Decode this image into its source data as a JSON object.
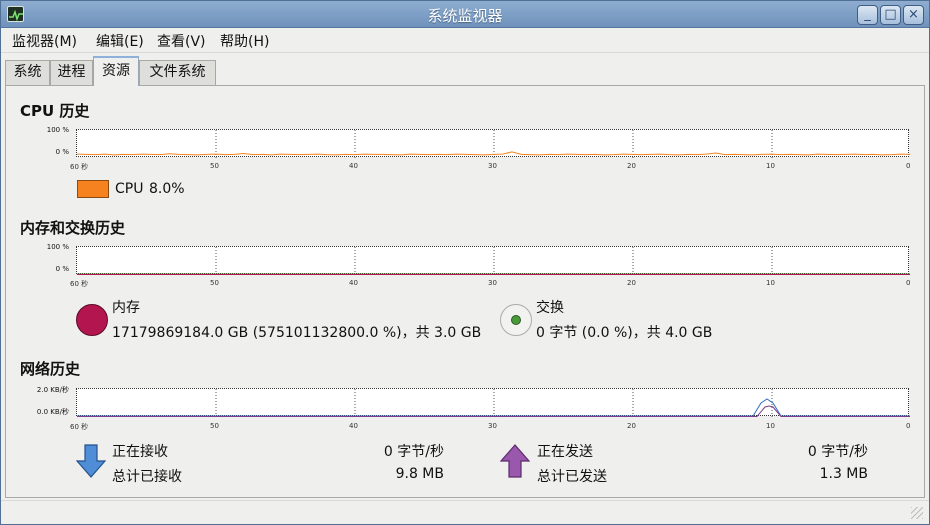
{
  "window": {
    "title": "系统监视器",
    "icon": "system-monitor-icon",
    "controls": {
      "minimize": "_",
      "maximize": "□",
      "close": "×"
    }
  },
  "menu": [
    {
      "label": "监视器(M)"
    },
    {
      "label": "编辑(E)"
    },
    {
      "label": "查看(V)"
    },
    {
      "label": "帮助(H)"
    }
  ],
  "tabs": [
    {
      "label": "系统",
      "active": false
    },
    {
      "label": "进程",
      "active": false
    },
    {
      "label": "资源",
      "active": true
    },
    {
      "label": "文件系统",
      "active": false
    }
  ],
  "x_ticks": [
    "60 秒",
    "50",
    "40",
    "30",
    "20",
    "10",
    "0"
  ],
  "cpu": {
    "title": "CPU 历史",
    "y_ticks": [
      "100 %",
      "0 %"
    ],
    "legend_label": "CPU",
    "legend_value": "8.0%",
    "color": "#f5821f",
    "series_percent": [
      14,
      13,
      12,
      14,
      11,
      13,
      12,
      14,
      13,
      12,
      15,
      13,
      12,
      11,
      13,
      14,
      12,
      13,
      16,
      12,
      13,
      11,
      14,
      13,
      12,
      13,
      14,
      12,
      11,
      13,
      12,
      14,
      13,
      13,
      12,
      11,
      14,
      13,
      12,
      13,
      12,
      14,
      13,
      12,
      11,
      13,
      14,
      22,
      13,
      12,
      11,
      13,
      12,
      14,
      13,
      12,
      13,
      11,
      12,
      14,
      13,
      12,
      13,
      14,
      12,
      11,
      13,
      12,
      14,
      18,
      12,
      13,
      12,
      11,
      13,
      14,
      12,
      13,
      12,
      11,
      14,
      13,
      12,
      13,
      14,
      12,
      13,
      11,
      12,
      14,
      13
    ]
  },
  "memory": {
    "title": "内存和交换历史",
    "y_ticks": [
      "100 %",
      "0 %"
    ],
    "mem_label": "内存",
    "mem_value": "17179869184.0 GB (575101132800.0 %)，共 3.0 GB",
    "mem_color": "#b3164f",
    "swap_label": "交换",
    "swap_value": "0 字节 (0.0 %)，共 4.0 GB",
    "swap_color": "#4a9a3a"
  },
  "network": {
    "title": "网络历史",
    "y_ticks": [
      "2.0 KB/秒",
      "0.0 KB/秒"
    ],
    "recv_label": "正在接收",
    "recv_rate": "0 字节/秒",
    "recv_total_label": "总计已接收",
    "recv_total": "9.8 MB",
    "send_label": "正在发送",
    "send_rate": "0 字节/秒",
    "send_total_label": "总计已发送",
    "send_total": "1.3 MB",
    "recv_color": "#2d6fc6",
    "send_color": "#7a3c8c"
  }
}
